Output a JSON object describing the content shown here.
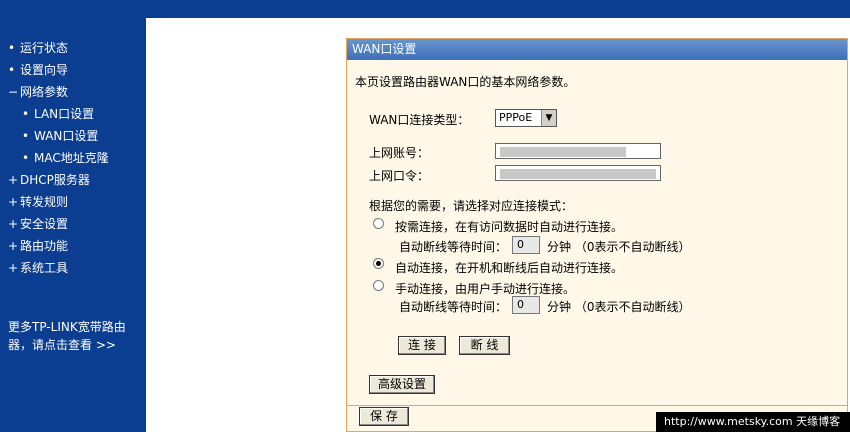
{
  "sidebar": {
    "items": [
      {
        "marker": "•",
        "label": "运行状态"
      },
      {
        "marker": "•",
        "label": "设置向导"
      },
      {
        "marker": "−",
        "label": "网络参数"
      },
      {
        "marker": "•",
        "label": "LAN口设置"
      },
      {
        "marker": "•",
        "label": "WAN口设置"
      },
      {
        "marker": "•",
        "label": "MAC地址克隆"
      },
      {
        "marker": "+",
        "label": "DHCP服务器"
      },
      {
        "marker": "+",
        "label": "转发规则"
      },
      {
        "marker": "+",
        "label": "安全设置"
      },
      {
        "marker": "+",
        "label": "路由功能"
      },
      {
        "marker": "+",
        "label": "系统工具"
      }
    ],
    "promo_line1": "更多TP-LINK宽带路由",
    "promo_line2": "器，请点击查看 >>"
  },
  "panel": {
    "title": "WAN口设置",
    "intro": "本页设置路由器WAN口的基本网络参数。",
    "conn_type_label": "WAN口连接类型：",
    "conn_type_value": "PPPoE",
    "account_label": "上网账号：",
    "password_label": "上网口令：",
    "mode_prompt": "根据您的需要，请选择对应连接模式：",
    "mode1_label": "按需连接，在有访问数据时自动进行连接。",
    "mode2_label": "自动连接，在开机和断线后自动进行连接。",
    "mode3_label": "手动连接，由用户手动进行连接。",
    "idle_label": "自动断线等待时间：",
    "idle1_value": "0",
    "idle3_value": "0",
    "idle_unit": "分钟 （0表示不自动断线）",
    "connect_button": "连 接",
    "disconnect_button": "断 线",
    "advanced_button": "高级设置",
    "save_button": "保 存",
    "selected_mode": 2
  },
  "watermark": "http://www.metsky.com 天缘博客",
  "colors": {
    "sidebar": "#0b3d91",
    "panel_bg": "#fff8e8",
    "panel_border": "#e6a55a",
    "header": "#3d6fb7"
  }
}
